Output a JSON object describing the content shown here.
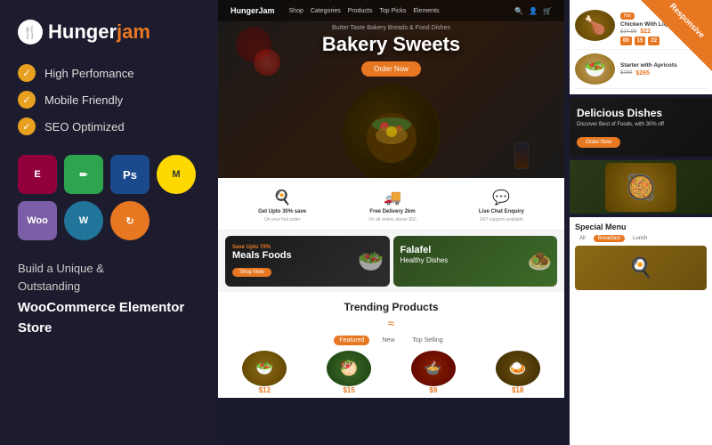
{
  "left": {
    "logo_hunger": "Hunger",
    "logo_jam": "jam",
    "features": [
      {
        "label": "High Perfomance"
      },
      {
        "label": "Mobile Friendly"
      },
      {
        "label": "SEO Optimized"
      }
    ],
    "plugins": [
      {
        "name": "elementor",
        "label": "E"
      },
      {
        "name": "edit",
        "label": "✏"
      },
      {
        "name": "photoshop",
        "label": "Ps"
      },
      {
        "name": "mailchimp",
        "label": "M"
      },
      {
        "name": "woocommerce",
        "label": "Woo"
      },
      {
        "name": "wordpress",
        "label": "W"
      },
      {
        "name": "sync",
        "label": "↻"
      }
    ],
    "build_line1": "Build a Unique &",
    "build_line2": "Outstanding",
    "build_bold": "WooCommerce Elementor Store"
  },
  "hero": {
    "nav_logo": "HungerJam",
    "nav_links": [
      "Shop",
      "Categories",
      "Products",
      "Top Picks",
      "Elements"
    ],
    "subtitle": "Butter Taste Bakery Breads & Food Dishes",
    "title": "Bakery Sweets",
    "btn_label": "Order Now"
  },
  "icons_row": [
    {
      "icon": "🍳",
      "title": "Get Upto 30% save",
      "desc": "On your first order"
    },
    {
      "icon": "🚚",
      "title": "Free Delivery 2km",
      "desc": "On all orders above $50"
    },
    {
      "icon": "📞",
      "title": "Live Chat Enquiry",
      "desc": "24/7 support available"
    }
  ],
  "promo": [
    {
      "save": "Save Upto 70%",
      "title": "Meals Foods",
      "subtitle": "",
      "cta": "Shop Now"
    },
    {
      "save": "",
      "title": "Falafel",
      "subtitle": "Healthy Dishes",
      "cta": ""
    }
  ],
  "trending": {
    "title": "Trending Products",
    "tabs": [
      "Featured",
      "New",
      "Top Selling"
    ],
    "products": [
      {
        "price": "$12"
      },
      {
        "price": "$15"
      },
      {
        "price": "$9"
      },
      {
        "price": "$18"
      }
    ]
  },
  "showcase": {
    "badge": "Hot",
    "items": [
      {
        "name": "Chicken With Liquid Filling",
        "old_price": "$24.99",
        "price": "$22",
        "countdown": [
          "00",
          "15",
          "22"
        ]
      },
      {
        "name": "Starter with Apricots",
        "old_price": "$299",
        "price": "$265"
      }
    ]
  },
  "delicious": {
    "title": "Delicious Dishes",
    "desc": "Discover Best of Foods, with 30% off",
    "btn": "Order Now"
  },
  "special": {
    "title": "Special Menu",
    "tabs": [
      "All",
      "Breakfast",
      "Lunch"
    ],
    "active_tab": "Breakfast"
  },
  "responsive_badge": "Responsive"
}
